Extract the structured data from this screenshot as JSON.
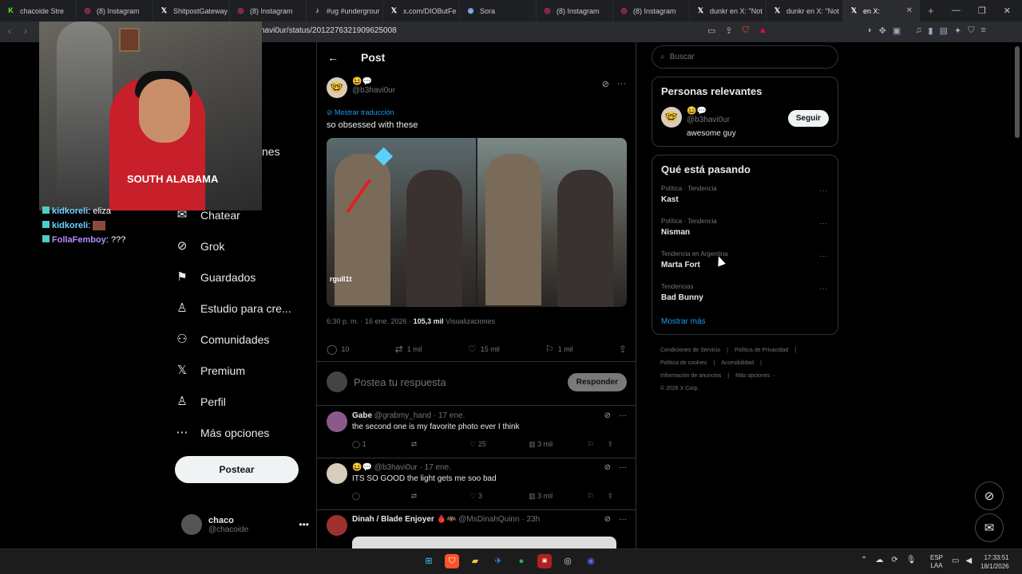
{
  "browser": {
    "tabs": [
      {
        "title": "chacoide Stre",
        "fav": "K",
        "color": "#53fc18"
      },
      {
        "title": "(8) Instagram",
        "fav": "◎",
        "color": "#e1306c"
      },
      {
        "title": "ShitpostGateway",
        "fav": "𝕏",
        "color": "#ffffff"
      },
      {
        "title": "(8) Instagram",
        "fav": "◎",
        "color": "#e1306c"
      },
      {
        "title": "#ug #undergrour",
        "fav": "♪",
        "color": "#ffffff"
      },
      {
        "title": "x.com/DIOButFe",
        "fav": "𝕏",
        "color": "#ffffff"
      },
      {
        "title": "Sora",
        "fav": "◉",
        "color": "#8ab4f8"
      },
      {
        "title": "(8) Instagram",
        "fav": "◎",
        "color": "#e1306c"
      },
      {
        "title": "(8) Instagram",
        "fav": "◎",
        "color": "#e1306c"
      },
      {
        "title": "dunkr en X: \"Not",
        "fav": "𝕏",
        "color": "#ffffff"
      },
      {
        "title": "dunkr en X: \"Not",
        "fav": "𝕏",
        "color": "#ffffff"
      },
      {
        "title": "en X:",
        "fav": "𝕏",
        "color": "#ffffff"
      }
    ],
    "url": "havi0ur/status/2012276321909625008"
  },
  "stream": {
    "shirt_text": "SOUTH ALABAMA",
    "chat": [
      {
        "user": "kidkoreli",
        "msg": "eliza",
        "cls": "u1"
      },
      {
        "user": "kidkoreli",
        "msg": "",
        "cls": "u1",
        "img": true
      },
      {
        "user": "FollaFemboy",
        "msg": "???",
        "cls": "u2"
      }
    ]
  },
  "leftnav": {
    "partial": "nes",
    "items": [
      {
        "label": "Chatear",
        "icon": "✉",
        "name": "chat"
      },
      {
        "label": "Grok",
        "icon": "⊘",
        "name": "grok"
      },
      {
        "label": "Guardados",
        "icon": "⚑",
        "name": "bookmarks"
      },
      {
        "label": "Estudio para cre...",
        "icon": "♙",
        "name": "creator-studio"
      },
      {
        "label": "Comunidades",
        "icon": "⚇",
        "name": "communities"
      },
      {
        "label": "Premium",
        "icon": "𝕏",
        "name": "premium"
      },
      {
        "label": "Perfil",
        "icon": "♙",
        "name": "profile"
      },
      {
        "label": "Más opciones",
        "icon": "⋯",
        "name": "more-options"
      }
    ],
    "post_button": "Postear",
    "account": {
      "name": "chaco",
      "handle": "@chacoide",
      "dots": "•••"
    }
  },
  "post": {
    "title": "Post",
    "author_emoji": "😆💬",
    "author_handle": "@b3havi0ur",
    "translate": "Mostrar traducción",
    "text": "so obsessed with these",
    "watermark": "rgull1t",
    "time": "6:30 p. m. · 16 ene. 2026 ·",
    "views": "105,3 mil",
    "views_label": "Visualizaciones",
    "replies": "10",
    "reposts": "1 mil",
    "likes": "15 mil",
    "bookmarks": "1 mil",
    "reply_placeholder": "Postea tu respuesta",
    "reply_button": "Responder"
  },
  "replies": [
    {
      "name": "Gabe",
      "handle": "@grabmy_hand · 17 ene.",
      "text": "the second one is my favorite photo ever I think",
      "replies": "1",
      "likes": "25",
      "views": "3 mil",
      "avatar": "#8b5a8a"
    },
    {
      "name": "😆💬",
      "handle": "@b3havi0ur · 17 ene.",
      "text": "ITS SO GOOD the light gets me soo bad",
      "replies": "",
      "likes": "3",
      "views": "3 mil",
      "avatar": "#d8cdbb"
    },
    {
      "name": "Dinah / Blade Enjoyer 🩸🦇",
      "handle": "@MsDinahQuinn · 23h",
      "text": "",
      "replies": "",
      "likes": "",
      "views": "",
      "avatar": "#a03030"
    }
  ],
  "sidebar": {
    "search_placeholder": "Buscar",
    "relevant_title": "Personas relevantes",
    "relevant": {
      "emoji": "😆💬",
      "handle": "@b3havi0ur",
      "bio": "awesome guy",
      "follow": "Seguir"
    },
    "trends_title": "Qué está pasando",
    "trends": [
      {
        "cat": "Política · Tendencia",
        "name": "Kast"
      },
      {
        "cat": "Política · Tendencia",
        "name": "Nisman"
      },
      {
        "cat": "Tendencia en Argentina",
        "name": "Marta Fort"
      },
      {
        "cat": "Tendencias",
        "name": "Bad Bunny"
      }
    ],
    "show_more": "Mostrar más",
    "footer": [
      "Condiciones de Servicio",
      "|",
      "Política de Privacidad",
      "|",
      "Política de cookies",
      "|",
      "Accesibilidad",
      "|",
      "Información de anuncios",
      "|",
      "Más opciones ···",
      "© 2026 X Corp."
    ]
  },
  "taskbar": {
    "lang": "ESP",
    "layout": "LAA",
    "time": "17:33:51",
    "date": "18/1/2026"
  }
}
